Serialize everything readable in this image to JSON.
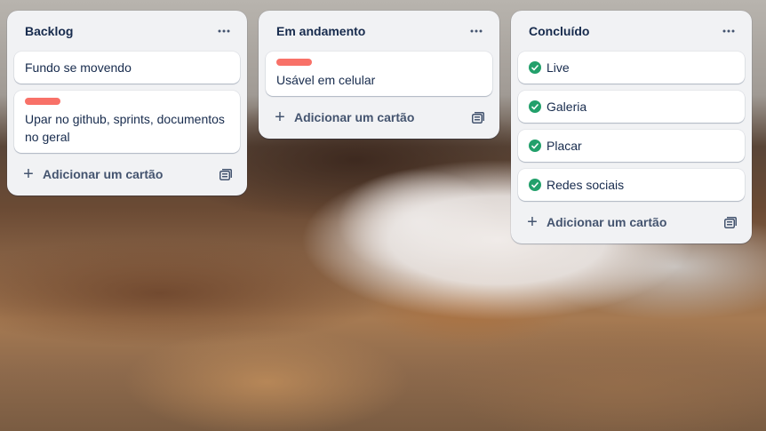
{
  "board": {
    "lists": [
      {
        "title": "Backlog",
        "more_icon": "more-horizontal-icon",
        "cards": [
          {
            "text": "Fundo se movendo",
            "label": false
          },
          {
            "text": "Upar no github, sprints, documentos no geral",
            "label": true,
            "label_color": "#f87168"
          }
        ],
        "add_label": "Adicionar um cartão"
      },
      {
        "title": "Em andamento",
        "more_icon": "more-horizontal-icon",
        "cards": [
          {
            "text": "Usável em celular",
            "label": true,
            "label_color": "#f87168"
          }
        ],
        "add_label": "Adicionar um cartão"
      },
      {
        "title": "Concluído",
        "more_icon": "more-horizontal-icon",
        "cards": [
          {
            "text": "Live",
            "done": true
          },
          {
            "text": "Galeria",
            "done": true
          },
          {
            "text": "Placar",
            "done": true
          },
          {
            "text": "Redes sociais",
            "done": true
          }
        ],
        "add_label": "Adicionar um cartão"
      }
    ]
  },
  "colors": {
    "list_bg": "#f1f2f4",
    "card_bg": "#ffffff",
    "text": "#172b4d",
    "muted": "#44546f",
    "label_red": "#f87168",
    "done_green": "#22a06b"
  }
}
